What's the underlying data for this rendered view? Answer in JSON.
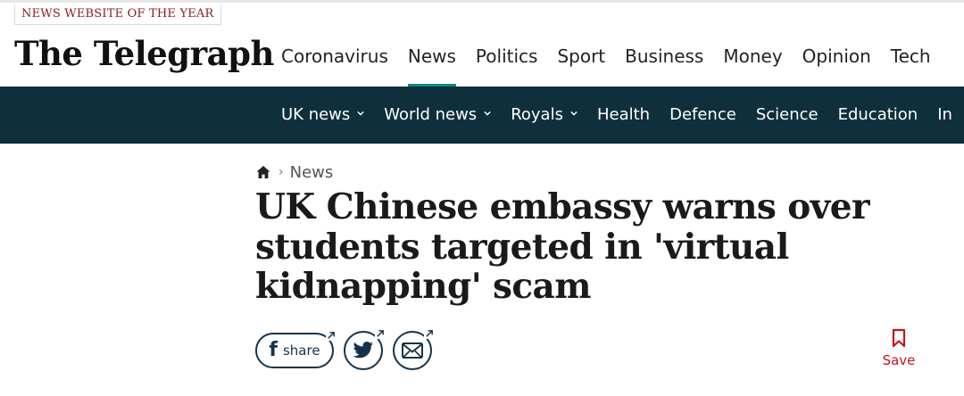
{
  "header": {
    "award_badge": "NEWS WEBSITE OF THE YEAR",
    "logo_text": "The Telegraph",
    "nav": [
      {
        "label": "Coronavirus"
      },
      {
        "label": "News"
      },
      {
        "label": "Politics"
      },
      {
        "label": "Sport"
      },
      {
        "label": "Business"
      },
      {
        "label": "Money"
      },
      {
        "label": "Opinion"
      },
      {
        "label": "Tech"
      }
    ],
    "active_nav": "News",
    "accent_color": "#13887c"
  },
  "subnav": {
    "background_color": "#0f2f3d",
    "items": [
      {
        "label": "UK news",
        "has_dropdown": true
      },
      {
        "label": "World news",
        "has_dropdown": true
      },
      {
        "label": "Royals",
        "has_dropdown": true
      },
      {
        "label": "Health",
        "has_dropdown": false
      },
      {
        "label": "Defence",
        "has_dropdown": false
      },
      {
        "label": "Science",
        "has_dropdown": false
      },
      {
        "label": "Education",
        "has_dropdown": false
      },
      {
        "label": "In",
        "has_dropdown": false
      }
    ]
  },
  "article": {
    "breadcrumb": {
      "home_icon": "home-icon",
      "section": "News"
    },
    "headline": "UK Chinese embassy warns over students targeted in 'virtual kidnapping' scam"
  },
  "share": {
    "facebook_label": "share",
    "icons": [
      "facebook-icon",
      "twitter-icon",
      "email-icon"
    ],
    "button_color": "#15334a"
  },
  "save": {
    "label": "Save",
    "icon": "bookmark-icon",
    "color": "#c4141b"
  }
}
